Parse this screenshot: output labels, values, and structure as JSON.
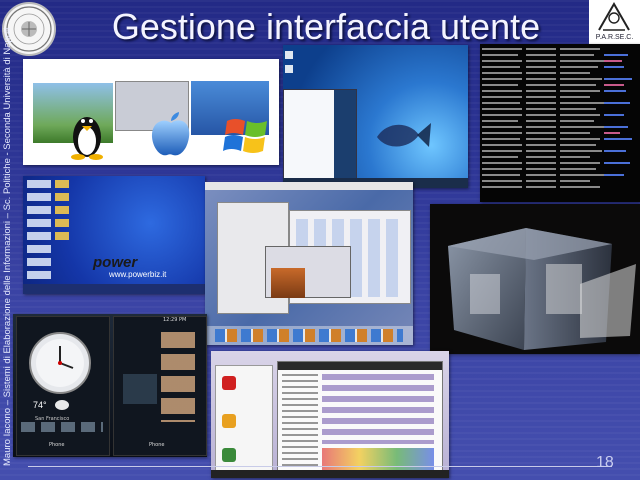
{
  "slide": {
    "title": "Gestione interfaccia utente",
    "vertical_footer": "Mauro Iacono – Sistemi di Elaborazione delle Informazioni – Sc. Politiche - Seconda Università di Napoli",
    "page_number": "18"
  },
  "logos": {
    "right_label": "P.A.R.SE.C."
  },
  "screens": {
    "mobile_weather": "74°",
    "mobile_city": "San Francisco",
    "mobile_phone_left": "Phone",
    "mobile_phone_right": "Phone",
    "mobile_time": "12:29 PM",
    "powerbiz_text": "www.powerbiz.it"
  },
  "colors": {
    "background_top": "#232a86",
    "background_bottom": "#444eae",
    "title": "#f4f4ff"
  }
}
